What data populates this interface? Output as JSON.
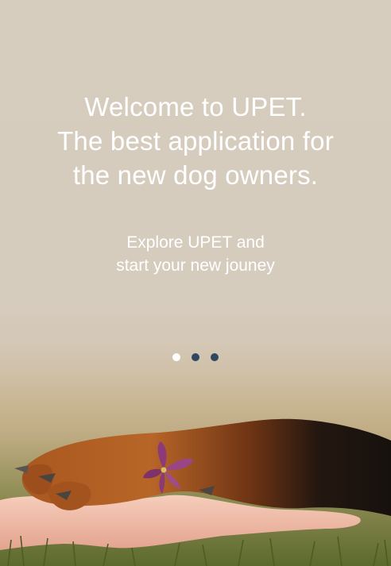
{
  "onboarding": {
    "headline_lines": [
      "Welcome to UPET.",
      "The best application for",
      "the new dog owners."
    ],
    "subtext_lines": [
      "Explore UPET and",
      "start your new jouney"
    ],
    "pager": {
      "total_pages": 3,
      "active_page": 1
    }
  },
  "colors": {
    "background": "#d7cdbf",
    "text": "#ffffff",
    "dot_active": "#ffffff",
    "dot_inactive": "#2f4761"
  },
  "image": {
    "subject": "dog-paw-in-human-hand-with-flower-photo"
  }
}
